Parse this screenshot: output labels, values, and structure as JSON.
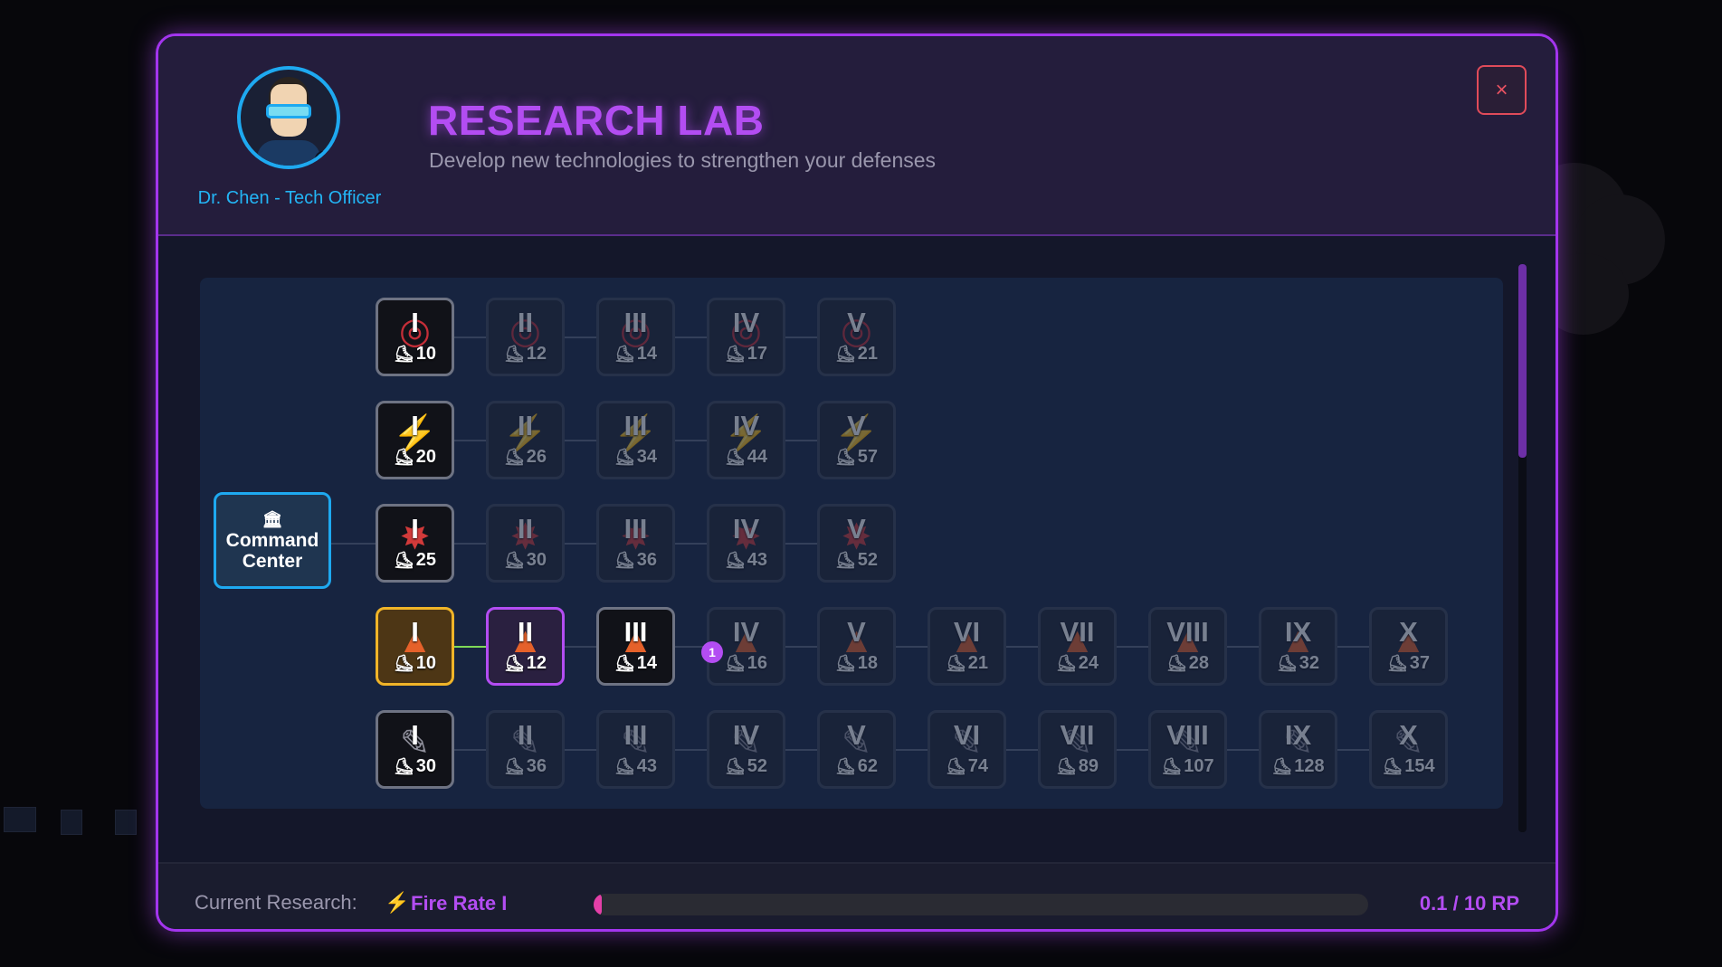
{
  "colors": {
    "accent": "#b34df2",
    "officer": "#1ea9f0",
    "completed": "#f0b428",
    "link_active": "#7ed957",
    "progress": "#e43fa8",
    "close": "#e04b5a"
  },
  "header": {
    "title": "RESEARCH LAB",
    "subtitle": "Develop new technologies to strengthen your defenses",
    "officer_name": "Dr. Chen - Tech Officer",
    "avatar_icon": "scientist-avatar",
    "close_label": "×"
  },
  "tree": {
    "root": {
      "line1": "Command",
      "line2": "Center",
      "icon": "🏛"
    },
    "cost_icon": "⛸",
    "badge": "1",
    "rows": [
      {
        "icon": "target",
        "icon_glyph": "◎",
        "nodes": [
          {
            "tier": "I",
            "cost": "10",
            "state": "unlocked"
          },
          {
            "tier": "II",
            "cost": "12",
            "state": "locked"
          },
          {
            "tier": "III",
            "cost": "14",
            "state": "locked"
          },
          {
            "tier": "IV",
            "cost": "17",
            "state": "locked"
          },
          {
            "tier": "V",
            "cost": "21",
            "state": "locked"
          }
        ]
      },
      {
        "icon": "bolt",
        "icon_glyph": "⚡",
        "nodes": [
          {
            "tier": "I",
            "cost": "20",
            "state": "unlocked"
          },
          {
            "tier": "II",
            "cost": "26",
            "state": "locked"
          },
          {
            "tier": "III",
            "cost": "34",
            "state": "locked"
          },
          {
            "tier": "IV",
            "cost": "44",
            "state": "locked"
          },
          {
            "tier": "V",
            "cost": "57",
            "state": "locked"
          }
        ]
      },
      {
        "icon": "burst",
        "icon_glyph": "✸",
        "nodes": [
          {
            "tier": "I",
            "cost": "25",
            "state": "unlocked"
          },
          {
            "tier": "II",
            "cost": "30",
            "state": "locked"
          },
          {
            "tier": "III",
            "cost": "36",
            "state": "locked"
          },
          {
            "tier": "IV",
            "cost": "43",
            "state": "locked"
          },
          {
            "tier": "V",
            "cost": "52",
            "state": "locked"
          }
        ]
      },
      {
        "icon": "flame",
        "icon_glyph": "▲",
        "nodes": [
          {
            "tier": "I",
            "cost": "10",
            "state": "completed"
          },
          {
            "tier": "II",
            "cost": "12",
            "state": "researching"
          },
          {
            "tier": "III",
            "cost": "14",
            "state": "unlocked"
          },
          {
            "tier": "IV",
            "cost": "16",
            "state": "locked"
          },
          {
            "tier": "V",
            "cost": "18",
            "state": "locked"
          },
          {
            "tier": "VI",
            "cost": "21",
            "state": "locked"
          },
          {
            "tier": "VII",
            "cost": "24",
            "state": "locked"
          },
          {
            "tier": "VIII",
            "cost": "28",
            "state": "locked"
          },
          {
            "tier": "IX",
            "cost": "32",
            "state": "locked"
          },
          {
            "tier": "X",
            "cost": "37",
            "state": "locked"
          }
        ]
      },
      {
        "icon": "wrench",
        "icon_glyph": "✎",
        "nodes": [
          {
            "tier": "I",
            "cost": "30",
            "state": "unlocked"
          },
          {
            "tier": "II",
            "cost": "36",
            "state": "locked"
          },
          {
            "tier": "III",
            "cost": "43",
            "state": "locked"
          },
          {
            "tier": "IV",
            "cost": "52",
            "state": "locked"
          },
          {
            "tier": "V",
            "cost": "62",
            "state": "locked"
          },
          {
            "tier": "VI",
            "cost": "74",
            "state": "locked"
          },
          {
            "tier": "VII",
            "cost": "89",
            "state": "locked"
          },
          {
            "tier": "VIII",
            "cost": "107",
            "state": "locked"
          },
          {
            "tier": "IX",
            "cost": "128",
            "state": "locked"
          },
          {
            "tier": "X",
            "cost": "154",
            "state": "locked"
          }
        ]
      }
    ]
  },
  "footer": {
    "label": "Current Research:",
    "icon": "⚡",
    "research_name": "Fire Rate I",
    "progress_value": 0.1,
    "progress_max": 10,
    "progress_text": "0.1 / 10 RP"
  }
}
